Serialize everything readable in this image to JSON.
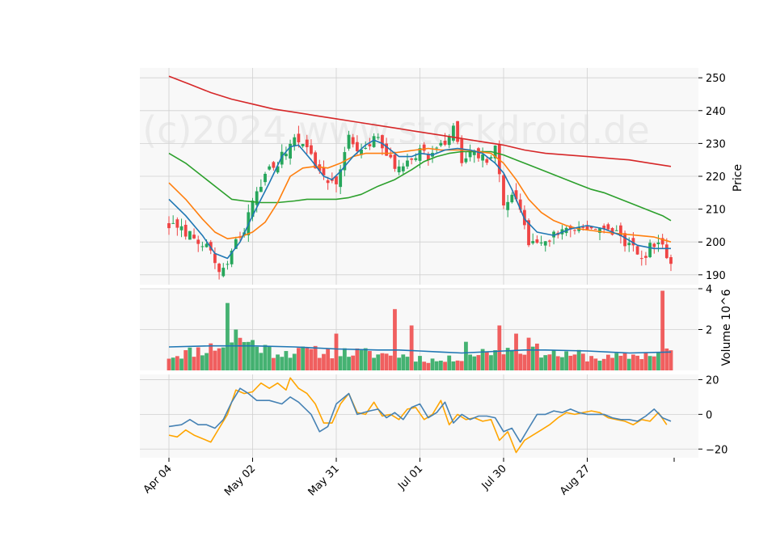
{
  "watermark": "(c)2024 www.stockdroid.de",
  "colors": {
    "up": "#26a65b",
    "down": "#ef4444",
    "sma_short": "#1f77b4",
    "sma_mid": "#ff7f0e",
    "sma_long": "#2ca02c",
    "sma_200": "#d62728",
    "vol_avg": "#1f77b4",
    "osc_a": "#4682b4",
    "osc_b": "#ffa500",
    "panel_bg": "#f8f8f8",
    "grid": "#d0d0d0"
  },
  "chart_data": {
    "type": "candlestick",
    "x_ticks": [
      "Apr 04",
      "May 02",
      "May 31",
      "Jul 01",
      "Jul 30",
      "Aug 27"
    ],
    "x_tick_index": [
      0,
      20,
      40,
      60,
      80,
      100
    ],
    "n_bars": 121,
    "price_panel": {
      "ylabel": "Price",
      "ylim": [
        187,
        253
      ],
      "yticks": [
        190,
        200,
        210,
        220,
        230,
        240,
        250
      ],
      "close_anchors": [
        [
          0,
          205
        ],
        [
          4,
          203
        ],
        [
          8,
          200
        ],
        [
          10,
          196
        ],
        [
          12,
          191
        ],
        [
          14,
          193
        ],
        [
          16,
          200
        ],
        [
          18,
          203
        ],
        [
          20,
          213
        ],
        [
          22,
          218
        ],
        [
          24,
          222
        ],
        [
          26,
          224
        ],
        [
          28,
          228
        ],
        [
          30,
          232
        ],
        [
          32,
          231
        ],
        [
          34,
          226
        ],
        [
          37,
          219
        ],
        [
          40,
          218
        ],
        [
          43,
          232
        ],
        [
          46,
          227
        ],
        [
          50,
          232
        ],
        [
          54,
          222
        ],
        [
          56,
          224
        ],
        [
          60,
          228
        ],
        [
          62,
          226
        ],
        [
          66,
          230
        ],
        [
          68,
          235
        ],
        [
          70,
          224
        ],
        [
          72,
          227
        ],
        [
          76,
          225
        ],
        [
          78,
          228
        ],
        [
          80,
          212
        ],
        [
          82,
          215
        ],
        [
          85,
          206
        ],
        [
          86,
          199
        ],
        [
          88,
          200
        ],
        [
          91,
          201
        ],
        [
          93,
          203
        ],
        [
          96,
          204
        ],
        [
          100,
          205
        ],
        [
          104,
          203
        ],
        [
          107,
          203
        ],
        [
          109,
          200
        ],
        [
          111,
          198
        ],
        [
          113,
          194
        ],
        [
          115,
          199
        ],
        [
          118,
          198
        ],
        [
          120,
          194
        ]
      ],
      "sma_short": [
        [
          0,
          213
        ],
        [
          4,
          208
        ],
        [
          8,
          202
        ],
        [
          11,
          196.5
        ],
        [
          14,
          195
        ],
        [
          17,
          200
        ],
        [
          20,
          208
        ],
        [
          24,
          218
        ],
        [
          27,
          226
        ],
        [
          29,
          229
        ],
        [
          31,
          229.5
        ],
        [
          34,
          225
        ],
        [
          37,
          220
        ],
        [
          39,
          219
        ],
        [
          41,
          221.5
        ],
        [
          44,
          226
        ],
        [
          47,
          229.5
        ],
        [
          49,
          231
        ],
        [
          51,
          230
        ],
        [
          53,
          228
        ],
        [
          55,
          226
        ],
        [
          58,
          226
        ],
        [
          60,
          227
        ],
        [
          63,
          226.5
        ],
        [
          66,
          228
        ],
        [
          69,
          228.5
        ],
        [
          72,
          228
        ],
        [
          75,
          227
        ],
        [
          78,
          224
        ],
        [
          80,
          221
        ],
        [
          82,
          216
        ],
        [
          85,
          207
        ],
        [
          88,
          203
        ],
        [
          92,
          202
        ],
        [
          96,
          204
        ],
        [
          100,
          205
        ],
        [
          104,
          204
        ],
        [
          108,
          202
        ],
        [
          112,
          199
        ],
        [
          116,
          198
        ],
        [
          120,
          198
        ]
      ],
      "sma_mid": [
        [
          0,
          218
        ],
        [
          4,
          213
        ],
        [
          8,
          207
        ],
        [
          11,
          203
        ],
        [
          14,
          201
        ],
        [
          17,
          201.5
        ],
        [
          20,
          203
        ],
        [
          23,
          206
        ],
        [
          26,
          212
        ],
        [
          29,
          220
        ],
        [
          32,
          222.5
        ],
        [
          35,
          223
        ],
        [
          38,
          222.5
        ],
        [
          41,
          224
        ],
        [
          44,
          226
        ],
        [
          47,
          227
        ],
        [
          50,
          227
        ],
        [
          53,
          227
        ],
        [
          56,
          227.5
        ],
        [
          59,
          228
        ],
        [
          62,
          228.5
        ],
        [
          65,
          228
        ],
        [
          68,
          228
        ],
        [
          71,
          228
        ],
        [
          74,
          227.5
        ],
        [
          77,
          227
        ],
        [
          80,
          224
        ],
        [
          83,
          219
        ],
        [
          86,
          213
        ],
        [
          89,
          209
        ],
        [
          92,
          206.5
        ],
        [
          95,
          205
        ],
        [
          98,
          204
        ],
        [
          101,
          203.5
        ],
        [
          104,
          203
        ],
        [
          108,
          202.5
        ],
        [
          112,
          202
        ],
        [
          116,
          201.5
        ],
        [
          120,
          200
        ]
      ],
      "sma_long": [
        [
          0,
          227
        ],
        [
          4,
          224
        ],
        [
          8,
          220
        ],
        [
          12,
          216
        ],
        [
          15,
          213
        ],
        [
          18,
          212.5
        ],
        [
          22,
          212
        ],
        [
          26,
          212
        ],
        [
          30,
          212.5
        ],
        [
          33,
          213
        ],
        [
          37,
          213
        ],
        [
          40,
          213
        ],
        [
          43,
          213.5
        ],
        [
          46,
          214.5
        ],
        [
          50,
          217
        ],
        [
          54,
          219
        ],
        [
          58,
          222
        ],
        [
          61,
          224.5
        ],
        [
          64,
          226
        ],
        [
          67,
          227
        ],
        [
          70,
          227.5
        ],
        [
          74,
          227.5
        ],
        [
          77,
          227.5
        ],
        [
          80,
          226.5
        ],
        [
          83,
          225
        ],
        [
          86,
          223.5
        ],
        [
          89,
          222
        ],
        [
          92,
          220.5
        ],
        [
          95,
          219
        ],
        [
          98,
          217.5
        ],
        [
          101,
          216
        ],
        [
          104,
          215
        ],
        [
          107,
          213.5
        ],
        [
          110,
          212
        ],
        [
          113,
          210.5
        ],
        [
          116,
          209
        ],
        [
          118,
          208
        ],
        [
          120,
          206.5
        ]
      ],
      "sma_200": [
        [
          0,
          250.5
        ],
        [
          5,
          248
        ],
        [
          10,
          245.5
        ],
        [
          15,
          243.5
        ],
        [
          20,
          242
        ],
        [
          25,
          240.5
        ],
        [
          30,
          239.5
        ],
        [
          35,
          238.5
        ],
        [
          40,
          237.5
        ],
        [
          45,
          236.5
        ],
        [
          50,
          235.5
        ],
        [
          55,
          234.5
        ],
        [
          60,
          233.5
        ],
        [
          65,
          232.5
        ],
        [
          70,
          231.5
        ],
        [
          75,
          230.5
        ],
        [
          80,
          229.5
        ],
        [
          85,
          228
        ],
        [
          90,
          227
        ],
        [
          95,
          226.5
        ],
        [
          100,
          226
        ],
        [
          105,
          225.5
        ],
        [
          110,
          225
        ],
        [
          115,
          224
        ],
        [
          120,
          223
        ]
      ]
    },
    "volume_panel": {
      "ylabel": "Volume  10^6",
      "ylim": [
        0,
        4
      ],
      "yticks": [
        2,
        4
      ],
      "base_volume_anchors": [
        [
          0,
          0.7
        ],
        [
          10,
          1.1
        ],
        [
          18,
          1.5
        ],
        [
          25,
          0.9
        ],
        [
          35,
          0.9
        ],
        [
          45,
          0.85
        ],
        [
          55,
          0.75
        ],
        [
          65,
          0.45
        ],
        [
          75,
          0.9
        ],
        [
          85,
          1.1
        ],
        [
          95,
          0.7
        ],
        [
          105,
          0.6
        ],
        [
          115,
          0.8
        ],
        [
          120,
          1.0
        ]
      ],
      "spikes": [
        [
          14,
          3.3
        ],
        [
          16,
          2.0
        ],
        [
          31,
          1.1
        ],
        [
          40,
          1.8
        ],
        [
          54,
          3.0
        ],
        [
          58,
          2.2
        ],
        [
          71,
          1.4
        ],
        [
          79,
          2.2
        ],
        [
          83,
          1.8
        ],
        [
          86,
          1.6
        ],
        [
          98,
          1.0
        ],
        [
          118,
          3.9
        ]
      ],
      "avg_volume": [
        [
          0,
          1.15
        ],
        [
          10,
          1.2
        ],
        [
          20,
          1.2
        ],
        [
          30,
          1.15
        ],
        [
          40,
          1.05
        ],
        [
          50,
          1.0
        ],
        [
          55,
          1.0
        ],
        [
          60,
          0.95
        ],
        [
          65,
          0.9
        ],
        [
          70,
          0.85
        ],
        [
          80,
          0.95
        ],
        [
          85,
          1.0
        ],
        [
          90,
          1.0
        ],
        [
          100,
          0.95
        ],
        [
          110,
          0.85
        ],
        [
          120,
          0.9
        ]
      ]
    },
    "oscillator_panel": {
      "ylim": [
        -25,
        23
      ],
      "yticks": [
        20,
        0,
        -20
      ],
      "line_a": [
        [
          0,
          -7
        ],
        [
          3,
          -6
        ],
        [
          5,
          -3
        ],
        [
          7,
          -6
        ],
        [
          9,
          -6
        ],
        [
          11,
          -8
        ],
        [
          13,
          -3
        ],
        [
          15,
          7
        ],
        [
          17,
          15
        ],
        [
          19,
          12
        ],
        [
          21,
          8
        ],
        [
          24,
          8
        ],
        [
          27,
          6
        ],
        [
          29,
          10
        ],
        [
          31,
          7
        ],
        [
          34,
          0
        ],
        [
          36,
          -10
        ],
        [
          38,
          -7
        ],
        [
          40,
          6
        ],
        [
          43,
          12
        ],
        [
          45,
          0
        ],
        [
          48,
          2
        ],
        [
          50,
          3
        ],
        [
          52,
          -2
        ],
        [
          54,
          1
        ],
        [
          56,
          -3
        ],
        [
          58,
          4
        ],
        [
          60,
          6
        ],
        [
          62,
          -2
        ],
        [
          64,
          1
        ],
        [
          66,
          7
        ],
        [
          68,
          -5
        ],
        [
          70,
          0
        ],
        [
          72,
          -3
        ],
        [
          74,
          -1
        ],
        [
          76,
          -1
        ],
        [
          78,
          -2
        ],
        [
          80,
          -10
        ],
        [
          82,
          -8
        ],
        [
          84,
          -16
        ],
        [
          86,
          -8
        ],
        [
          88,
          0
        ],
        [
          90,
          0
        ],
        [
          92,
          2
        ],
        [
          94,
          1
        ],
        [
          96,
          3
        ],
        [
          98,
          1
        ],
        [
          100,
          0
        ],
        [
          104,
          0
        ],
        [
          106,
          -2
        ],
        [
          108,
          -3
        ],
        [
          110,
          -3
        ],
        [
          112,
          -4
        ],
        [
          114,
          -1
        ],
        [
          116,
          3
        ],
        [
          118,
          -2
        ],
        [
          120,
          -4
        ]
      ],
      "line_b": [
        [
          0,
          -12
        ],
        [
          2,
          -13
        ],
        [
          4,
          -9
        ],
        [
          6,
          -12
        ],
        [
          8,
          -14
        ],
        [
          10,
          -16
        ],
        [
          12,
          -8
        ],
        [
          14,
          0
        ],
        [
          16,
          14
        ],
        [
          18,
          12
        ],
        [
          20,
          13
        ],
        [
          22,
          18
        ],
        [
          24,
          15
        ],
        [
          26,
          18
        ],
        [
          28,
          14
        ],
        [
          29,
          21
        ],
        [
          31,
          15
        ],
        [
          33,
          12
        ],
        [
          35,
          6
        ],
        [
          37,
          -5
        ],
        [
          39,
          -5
        ],
        [
          41,
          6
        ],
        [
          43,
          12
        ],
        [
          45,
          1
        ],
        [
          47,
          0
        ],
        [
          49,
          7
        ],
        [
          51,
          -1
        ],
        [
          53,
          0
        ],
        [
          55,
          -3
        ],
        [
          57,
          3
        ],
        [
          59,
          4
        ],
        [
          61,
          -3
        ],
        [
          63,
          0
        ],
        [
          65,
          8
        ],
        [
          67,
          -6
        ],
        [
          69,
          0
        ],
        [
          71,
          -3
        ],
        [
          73,
          -2
        ],
        [
          75,
          -4
        ],
        [
          77,
          -3
        ],
        [
          79,
          -15
        ],
        [
          81,
          -10
        ],
        [
          83,
          -22
        ],
        [
          85,
          -15
        ],
        [
          87,
          -12
        ],
        [
          89,
          -9
        ],
        [
          91,
          -6
        ],
        [
          93,
          -2
        ],
        [
          95,
          1
        ],
        [
          97,
          0
        ],
        [
          99,
          1
        ],
        [
          101,
          2
        ],
        [
          103,
          1
        ],
        [
          105,
          -2
        ],
        [
          107,
          -3
        ],
        [
          109,
          -4
        ],
        [
          111,
          -6
        ],
        [
          113,
          -3
        ],
        [
          115,
          -4
        ],
        [
          117,
          1
        ],
        [
          119,
          -6
        ]
      ]
    }
  }
}
